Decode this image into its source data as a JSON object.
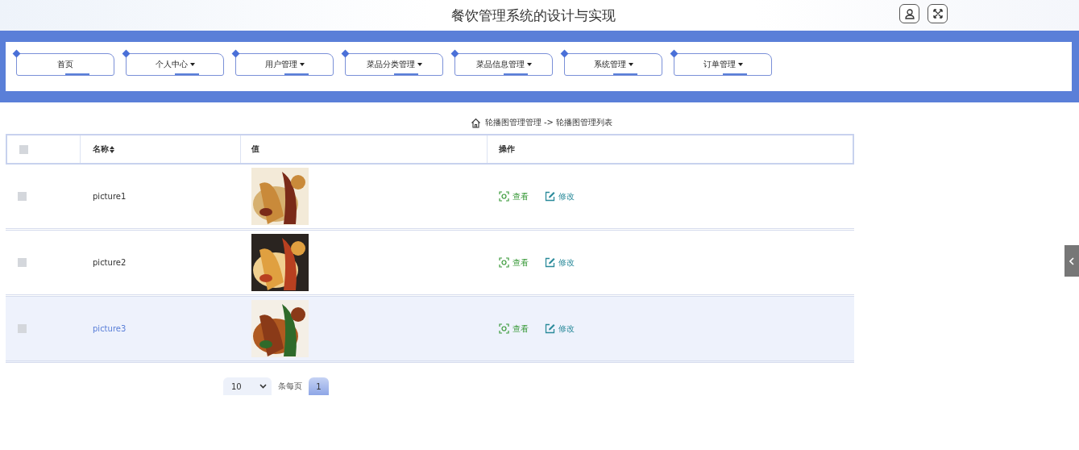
{
  "header": {
    "title": "餐饮管理系统的设计与实现"
  },
  "nav": [
    {
      "label": "首页",
      "dropdown": false
    },
    {
      "label": "个人中心",
      "dropdown": true
    },
    {
      "label": "用户管理",
      "dropdown": true
    },
    {
      "label": "菜品分类管理",
      "dropdown": true
    },
    {
      "label": "菜品信息管理",
      "dropdown": true
    },
    {
      "label": "系统管理",
      "dropdown": true
    },
    {
      "label": "订单管理",
      "dropdown": true
    }
  ],
  "breadcrumb": {
    "parent": "轮播图管理管理",
    "separator": "->",
    "current": "轮播图管理列表"
  },
  "table": {
    "select_all": {
      "checked": false
    },
    "columns": [
      "名称",
      "值",
      "操作"
    ],
    "rows": [
      {
        "checked": false,
        "highlighted": false,
        "name": "picture1",
        "value": {
          "kind": "picture"
        },
        "actions": [
          "查看",
          "修改"
        ]
      },
      {
        "checked": false,
        "highlighted": false,
        "name": "picture2",
        "value": {
          "kind": "picture"
        },
        "actions": [
          "查看",
          "修改"
        ]
      },
      {
        "checked": false,
        "highlighted": true,
        "name": "picture3",
        "value": {
          "kind": "picture"
        },
        "actions": [
          "查看",
          "修改"
        ]
      }
    ]
  },
  "pagination": {
    "page_size": "10",
    "page_size_label": "条每页",
    "pages": [
      {
        "label": "1",
        "selected": true
      }
    ]
  }
}
